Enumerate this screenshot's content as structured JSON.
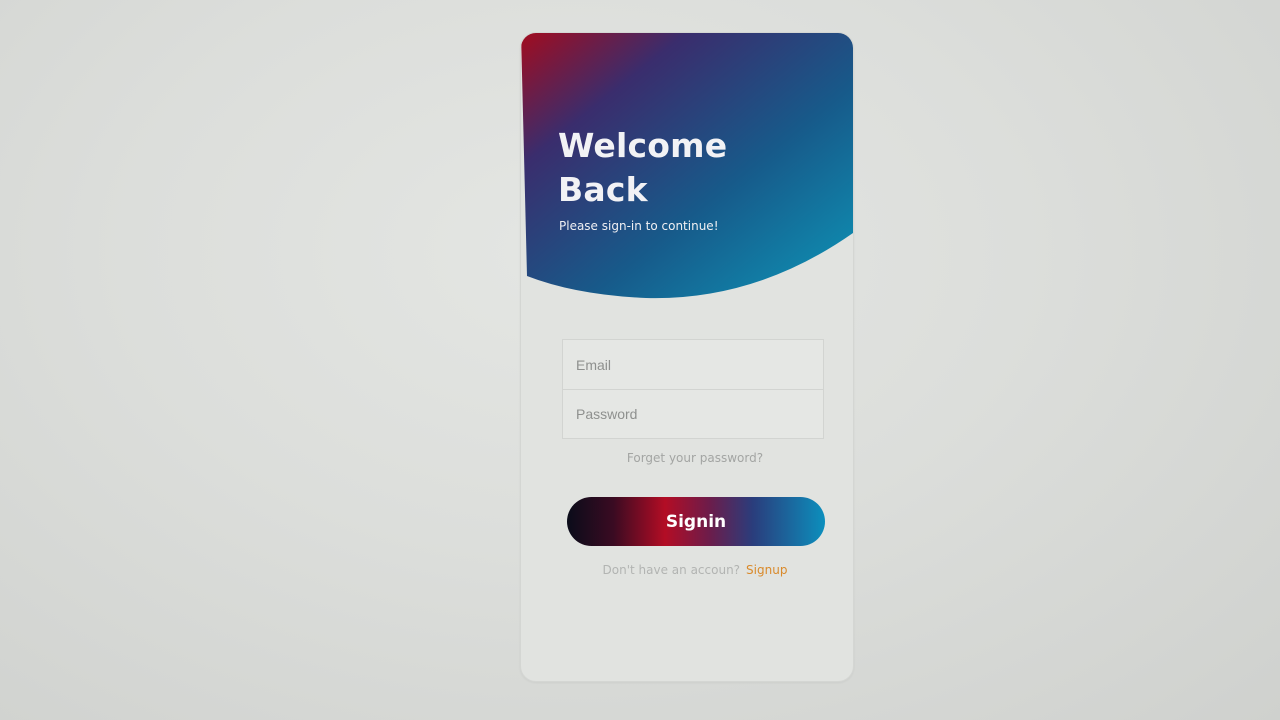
{
  "login": {
    "title": "Welcome Back",
    "subtitle": "Please sign-in to continue!",
    "email_placeholder": "Email",
    "password_placeholder": "Password",
    "forgot_password": "Forget your password?",
    "signin_label": "Signin",
    "signup_prompt": "Don't have an accoun?",
    "signup_link": "Signup"
  },
  "colors": {
    "hero_gradient": [
      "#a10c1f",
      "#3a2d6d",
      "#175a8a",
      "#0d96b8"
    ],
    "button_gradient": [
      "#0a0c1a",
      "#b30d25",
      "#2a3d7c",
      "#0c8fbd"
    ],
    "signup_link": "#d98a2b",
    "card_background": "#e1e3e0"
  }
}
